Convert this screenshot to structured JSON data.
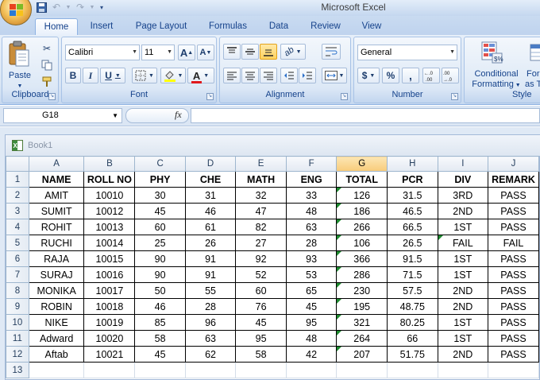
{
  "app": {
    "title": "Microsoft Excel"
  },
  "ribbon_tabs": [
    "Home",
    "Insert",
    "Page Layout",
    "Formulas",
    "Data",
    "Review",
    "View"
  ],
  "ribbon": {
    "clipboard": {
      "label": "Clipboard",
      "paste": "Paste"
    },
    "font": {
      "label": "Font",
      "font_name": "Calibri",
      "font_size": "11"
    },
    "alignment": {
      "label": "Alignment"
    },
    "number": {
      "label": "Number",
      "format": "General",
      "currency": "$",
      "percent": "%",
      "comma": ","
    },
    "styles": {
      "label": "Style",
      "conditional_line1": "Conditional",
      "conditional_line2": "Formatting",
      "format_as_line1": "For",
      "format_as_line2": "as Ta"
    }
  },
  "formula_bar": {
    "name_box": "G18",
    "fx": "fx",
    "formula": ""
  },
  "workbook": {
    "title": "Book1"
  },
  "sheet": {
    "columns": [
      "A",
      "B",
      "C",
      "D",
      "E",
      "F",
      "G",
      "H",
      "I",
      "J"
    ],
    "selected_column": "G",
    "header": [
      "NAME",
      "ROLL NO",
      "PHY",
      "CHE",
      "MATH",
      "ENG",
      "TOTAL",
      "PCR",
      "DIV",
      "REMARK"
    ],
    "rows": [
      [
        "AMIT",
        "10010",
        "30",
        "31",
        "32",
        "33",
        "126",
        "31.5",
        "3RD",
        "PASS"
      ],
      [
        "SUMIT",
        "10012",
        "45",
        "46",
        "47",
        "48",
        "186",
        "46.5",
        "2ND",
        "PASS"
      ],
      [
        "ROHIT",
        "10013",
        "60",
        "61",
        "82",
        "63",
        "266",
        "66.5",
        "1ST",
        "PASS"
      ],
      [
        "RUCHI",
        "10014",
        "25",
        "26",
        "27",
        "28",
        "106",
        "26.5",
        "FAIL",
        "FAIL"
      ],
      [
        "RAJA",
        "10015",
        "90",
        "91",
        "92",
        "93",
        "366",
        "91.5",
        "1ST",
        "PASS"
      ],
      [
        "SURAJ",
        "10016",
        "90",
        "91",
        "52",
        "53",
        "286",
        "71.5",
        "1ST",
        "PASS"
      ],
      [
        "MONIKA",
        "10017",
        "50",
        "55",
        "60",
        "65",
        "230",
        "57.5",
        "2ND",
        "PASS"
      ],
      [
        "ROBIN",
        "10018",
        "46",
        "28",
        "76",
        "45",
        "195",
        "48.75",
        "2ND",
        "PASS"
      ],
      [
        "NIKE",
        "10019",
        "85",
        "96",
        "45",
        "95",
        "321",
        "80.25",
        "1ST",
        "PASS"
      ],
      [
        "Adward",
        "10020",
        "58",
        "63",
        "95",
        "48",
        "264",
        "66",
        "1ST",
        "PASS"
      ],
      [
        "Aftab",
        "10021",
        "45",
        "62",
        "58",
        "42",
        "207",
        "51.75",
        "2ND",
        "PASS"
      ]
    ],
    "row_numbers": [
      "1",
      "2",
      "3",
      "4",
      "5",
      "6",
      "7",
      "8",
      "9",
      "10",
      "11",
      "12",
      "13"
    ]
  }
}
